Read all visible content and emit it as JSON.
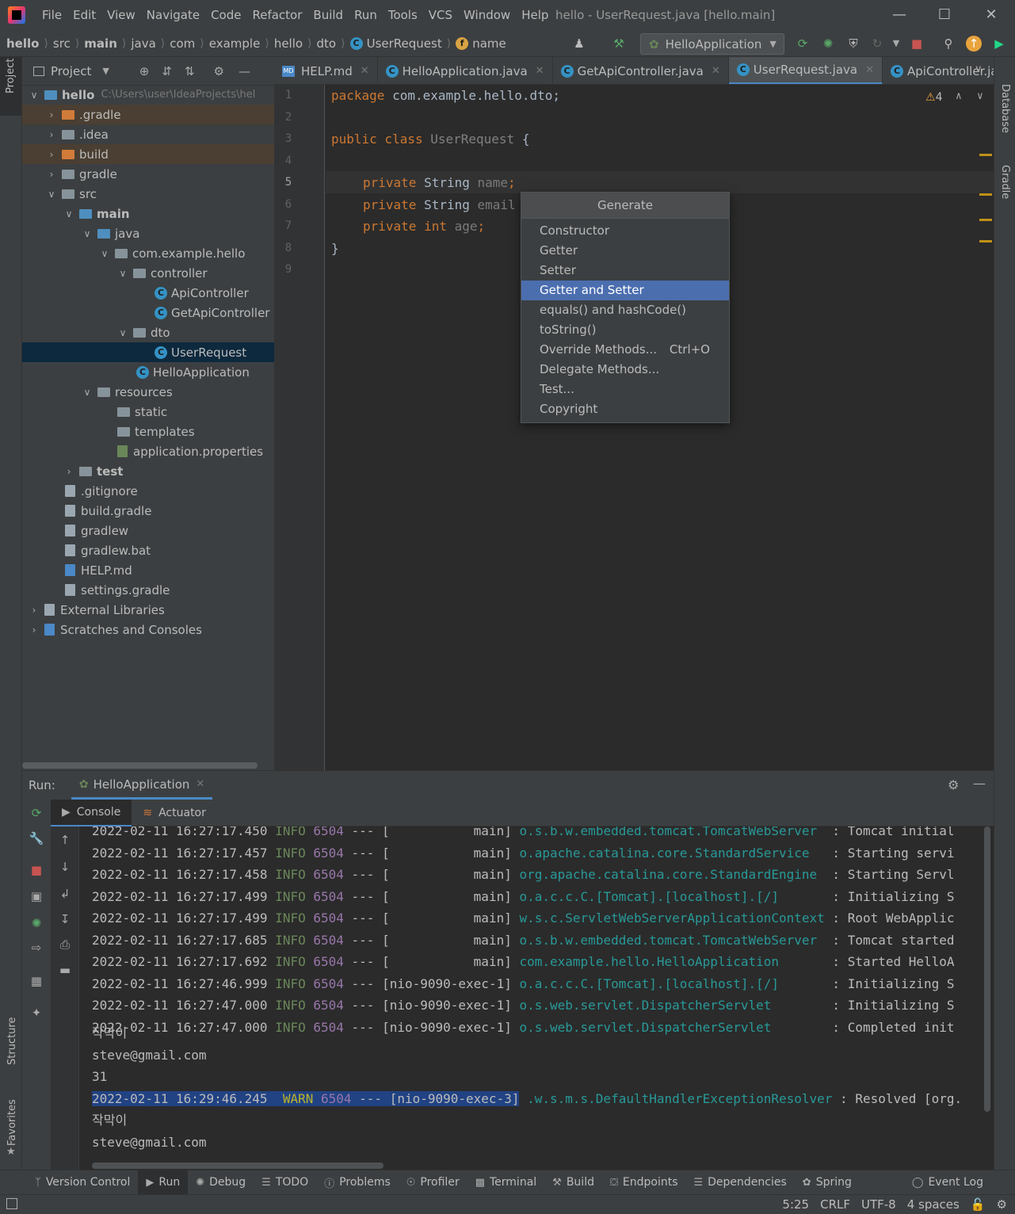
{
  "menu": [
    "File",
    "Edit",
    "View",
    "Navigate",
    "Code",
    "Refactor",
    "Build",
    "Run",
    "Tools",
    "VCS",
    "Window",
    "Help"
  ],
  "window_title": "hello - UserRequest.java [hello.main]",
  "breadcrumbs": [
    "hello",
    "src",
    "main",
    "java",
    "com",
    "example",
    "hello",
    "dto",
    "UserRequest",
    "name"
  ],
  "run_config": "HelloApplication",
  "project_panel": {
    "title": "Project",
    "root_name": "hello",
    "root_path": "C:\\Users\\user\\IdeaProjects\\hel",
    "items": [
      ".gradle",
      ".idea",
      "build",
      "gradle",
      "src",
      "main",
      "java",
      "com.example.hello",
      "controller",
      "ApiController",
      "GetApiController",
      "dto",
      "UserRequest",
      "HelloApplication",
      "resources",
      "static",
      "templates",
      "application.properties",
      "test",
      ".gitignore",
      "build.gradle",
      "gradlew",
      "gradlew.bat",
      "HELP.md",
      "settings.gradle",
      "External Libraries",
      "Scratches and Consoles"
    ]
  },
  "tabs": [
    "HELP.md",
    "HelloApplication.java",
    "GetApiController.java",
    "UserRequest.java",
    "ApiController.java"
  ],
  "editor": {
    "line_numbers": [
      "1",
      "2",
      "3",
      "4",
      "5",
      "6",
      "7",
      "8",
      "9"
    ],
    "warning_count": "4",
    "code": {
      "l1_kw": "package",
      "l1_rest": " com.example.hello.dto;",
      "l3_kw": "public class",
      "l3_name": " UserRequest",
      "l3_rest": " {",
      "l5_kw": "private",
      "l5_type": " String",
      "l5_field": " name",
      "l5_end": ";",
      "l6_kw": "private",
      "l6_type": " String",
      "l6_field": " email",
      "l7_kw": "private",
      "l7_type": " int",
      "l7_field": " age",
      "l7_end": ";",
      "l8": "}"
    }
  },
  "generate_popup": {
    "title": "Generate",
    "items": [
      "Constructor",
      "Getter",
      "Setter",
      "Getter and Setter",
      "equals() and hashCode()",
      "toString()",
      "Override Methods...",
      "Delegate Methods...",
      "Test...",
      "Copyright"
    ],
    "override_shortcut": "Ctrl+O",
    "selected": "Getter and Setter"
  },
  "run_panel": {
    "label": "Run:",
    "config": "HelloApplication",
    "sub_tabs": [
      "Console",
      "Actuator"
    ]
  },
  "console": {
    "lines": [
      {
        "ts": "2022-02-11 16:27:17.450",
        "lvl": " INFO",
        "pid": "6504",
        "sep": " --- ",
        "thread": "[           main]",
        "cls": "o.s.b.w.embedded.tomcat.TomcatWebServer ",
        "msg": " : Tomcat initial"
      },
      {
        "ts": "2022-02-11 16:27:17.457",
        "lvl": " INFO",
        "pid": "6504",
        "sep": " --- ",
        "thread": "[           main]",
        "cls": "o.apache.catalina.core.StandardService  ",
        "msg": " : Starting servi"
      },
      {
        "ts": "2022-02-11 16:27:17.458",
        "lvl": " INFO",
        "pid": "6504",
        "sep": " --- ",
        "thread": "[           main]",
        "cls": "org.apache.catalina.core.StandardEngine ",
        "msg": " : Starting Servl"
      },
      {
        "ts": "2022-02-11 16:27:17.499",
        "lvl": " INFO",
        "pid": "6504",
        "sep": " --- ",
        "thread": "[           main]",
        "cls": "o.a.c.c.C.[Tomcat].[localhost].[/]      ",
        "msg": " : Initializing S"
      },
      {
        "ts": "2022-02-11 16:27:17.499",
        "lvl": " INFO",
        "pid": "6504",
        "sep": " --- ",
        "thread": "[           main]",
        "cls": "w.s.c.ServletWebServerApplicationContext",
        "msg": " : Root WebApplic"
      },
      {
        "ts": "2022-02-11 16:27:17.685",
        "lvl": " INFO",
        "pid": "6504",
        "sep": " --- ",
        "thread": "[           main]",
        "cls": "o.s.b.w.embedded.tomcat.TomcatWebServer ",
        "msg": " : Tomcat started"
      },
      {
        "ts": "2022-02-11 16:27:17.692",
        "lvl": " INFO",
        "pid": "6504",
        "sep": " --- ",
        "thread": "[           main]",
        "cls": "com.example.hello.HelloApplication      ",
        "msg": " : Started HelloA"
      },
      {
        "ts": "2022-02-11 16:27:46.999",
        "lvl": " INFO",
        "pid": "6504",
        "sep": " --- ",
        "thread": "[nio-9090-exec-1]",
        "cls": "o.a.c.c.C.[Tomcat].[localhost].[/]      ",
        "msg": " : Initializing S"
      },
      {
        "ts": "2022-02-11 16:27:47.000",
        "lvl": " INFO",
        "pid": "6504",
        "sep": " --- ",
        "thread": "[nio-9090-exec-1]",
        "cls": "o.s.web.servlet.DispatcherServlet       ",
        "msg": " : Initializing S"
      },
      {
        "ts": "2022-02-11 16:27:47.000",
        "lvl": " INFO",
        "pid": "6504",
        "sep": " --- ",
        "thread": "[nio-9090-exec-1]",
        "cls": "o.s.web.servlet.DispatcherServlet       ",
        "msg": " : Completed init"
      }
    ],
    "out1": "작막이",
    "out2": "steve@gmail.com",
    "out3": "31",
    "warn_line": {
      "ts": "2022-02-11 16:29:46.245",
      "lvl": "  WARN",
      "pid": "6504",
      "sep": " --- ",
      "thread": "[nio-9090-exec-3]",
      "cls": " .w.s.m.s.DefaultHandlerExceptionResolver",
      "msg": " : Resolved [org."
    },
    "out4": "작막이",
    "out5": "steve@gmail.com"
  },
  "tool_windows": [
    "Version Control",
    "Run",
    "Debug",
    "TODO",
    "Problems",
    "Profiler",
    "Terminal",
    "Build",
    "Endpoints",
    "Dependencies",
    "Spring",
    "Event Log"
  ],
  "side_labels": {
    "left_top": "Project",
    "left_structure": "Structure",
    "left_favorites": "Favorites",
    "right_database": "Database",
    "right_gradle": "Gradle"
  },
  "status": {
    "position": "5:25",
    "line_sep": "CRLF",
    "encoding": "UTF-8",
    "indent": "4 spaces"
  }
}
